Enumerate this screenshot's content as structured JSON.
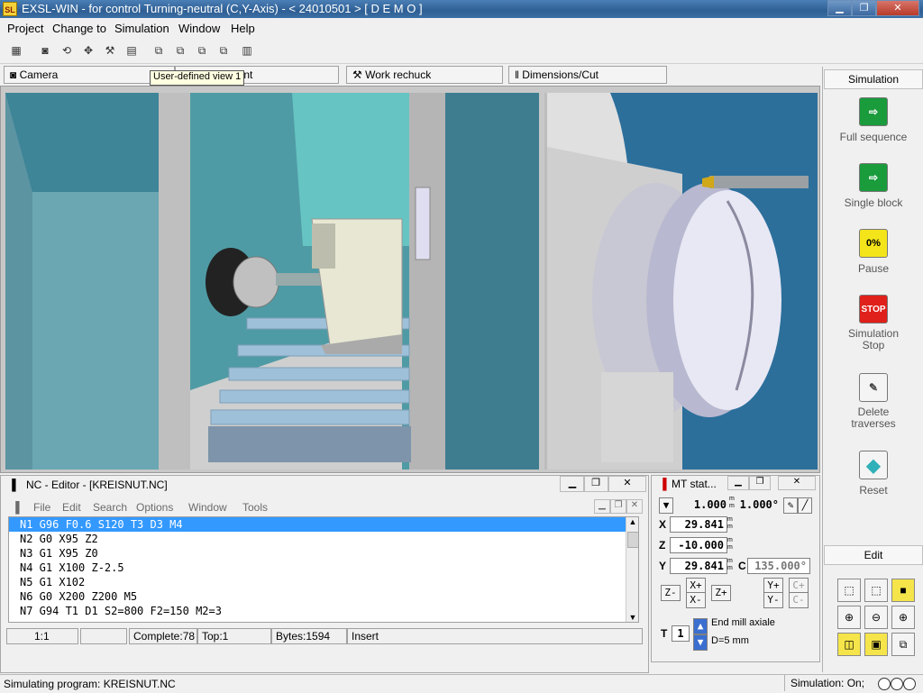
{
  "window": {
    "title": "EXSL-WIN - for control Turning-neutral (C,Y-Axis) - < 24010501 >  [ D E M O ]",
    "logo": "SL"
  },
  "menu": [
    "Project",
    "Change to",
    "Simulation",
    "Window",
    "Help"
  ],
  "tabs": {
    "camera": "Camera",
    "view_suffix": "oint",
    "work_rechuck": "Work rechuck",
    "dimensions_cut": "Dimensions/Cut",
    "tooltip": "User-defined view 1"
  },
  "sim_panel": {
    "header": "Simulation",
    "buttons": [
      {
        "id": "full-sequence",
        "label": "Full sequence",
        "icon": "arrow-right-icon",
        "glyph": "⇨"
      },
      {
        "id": "single-block",
        "label": "Single block",
        "icon": "step-arrow-icon",
        "glyph": "⇨"
      },
      {
        "id": "pause",
        "label": "Pause",
        "icon": "pause-icon",
        "glyph": "0%"
      },
      {
        "id": "simulation-stop",
        "label": "Simulation\nStop",
        "icon": "stop-icon",
        "glyph": "STOP"
      },
      {
        "id": "delete-traverses",
        "label": "Delete\ntraverses",
        "icon": "eraser-icon",
        "glyph": "✎"
      },
      {
        "id": "reset",
        "label": "Reset",
        "icon": "cube-icon",
        "glyph": "◆"
      }
    ],
    "edit_header": "Edit"
  },
  "nc_editor": {
    "title": "NC - Editor - [KREISNUT.NC]",
    "menu": [
      "File",
      "Edit",
      "Search",
      "Options",
      "Window",
      "Tools"
    ],
    "lines": [
      "N1 G96 F0.6 S120 T3 D3 M4",
      "N2 G0 X95 Z2",
      "N3 G1 X95 Z0",
      "N4 G1 X100 Z-2.5",
      "N5 G1 X102",
      "N6 G0 X200 Z200 M5",
      "N7 G94 T1 D1 S2=800 F2=150 M2=3"
    ],
    "status": {
      "position": "1:1",
      "complete": "Complete:78",
      "top": "Top:1",
      "bytes": "Bytes:1594",
      "mode": "Insert"
    }
  },
  "mt_status": {
    "title": "MT stat...",
    "scale1": "1.000",
    "scale1_unit": "m\nm",
    "scale2": "1.000°",
    "x_label": "X",
    "x_value": "29.841",
    "z_label": "Z",
    "z_value": "-10.000",
    "y_label": "Y",
    "y_value": "29.841",
    "c_label": "C",
    "c_value": "135.000°",
    "unit": "m\nm",
    "buttons": {
      "z_minus": "Z-",
      "x_plus": "X+",
      "x_minus": "X-",
      "z_plus": "Z+",
      "y_plus": "Y+",
      "y_minus": "Y-",
      "c_plus": "C+",
      "c_minus": "C-"
    },
    "tool_label": "T",
    "tool_number": "1",
    "tool_name": "End mill axiale",
    "tool_diameter": "D=5 mm"
  },
  "statusbar": {
    "message": "Simulating program: KREISNUT.NC",
    "simulation": "Simulation: On;"
  },
  "colors": {
    "viewport_bg": "#2c6f9b",
    "selection": "#3399ff",
    "green_btn": "#1a9b3c",
    "stop_btn": "#e0201a",
    "pause_btn": "#f3e51a"
  }
}
